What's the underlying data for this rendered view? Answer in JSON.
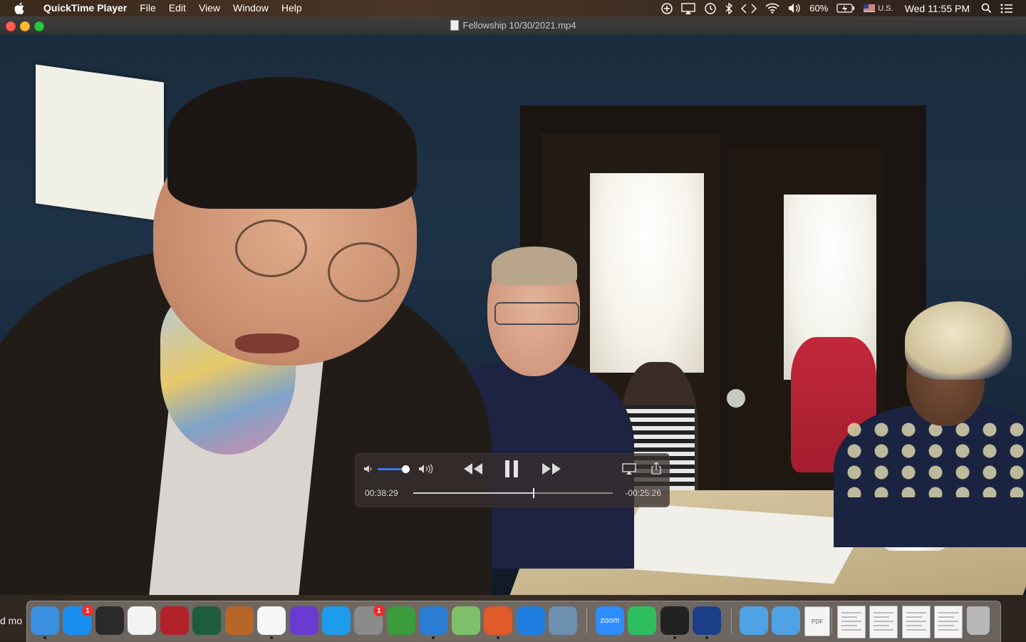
{
  "menubar": {
    "app_name": "QuickTime Player",
    "menus": [
      "File",
      "Edit",
      "View",
      "Window",
      "Help"
    ],
    "battery": "60%",
    "input_source": "U.S.",
    "clock": "Wed 11:55 PM"
  },
  "window": {
    "title": "Fellowship 10/30/2021.mp4"
  },
  "player": {
    "elapsed": "00:38:29",
    "remaining": "-00:25:26",
    "progress": 0.602,
    "volume": 0.87
  },
  "dock": {
    "left_edge_text": "d mo",
    "items": [
      {
        "name": "finder-icon",
        "color": "#3b8fe0",
        "running": true
      },
      {
        "name": "app-store-icon",
        "color": "#1a8ef0",
        "badge": "1",
        "running": false
      },
      {
        "name": "launchpad-icon",
        "color": "#2a2a2a",
        "running": false
      },
      {
        "name": "music-icon",
        "color": "#f3f3f3",
        "running": false
      },
      {
        "name": "photo-booth-icon",
        "color": "#b2222a",
        "running": false
      },
      {
        "name": "time-machine-icon",
        "color": "#1d5d3c",
        "running": false
      },
      {
        "name": "garageband-icon",
        "color": "#b7662a",
        "running": false
      },
      {
        "name": "photos-icon",
        "color": "#f6f6f6",
        "running": true
      },
      {
        "name": "imovie-icon",
        "color": "#6a3bd0",
        "running": false
      },
      {
        "name": "skype-icon",
        "color": "#1c9cea",
        "running": false
      },
      {
        "name": "system-preferences-icon",
        "color": "#8a8a8a",
        "badge": "1",
        "running": false
      },
      {
        "name": "sketchup-icon",
        "color": "#3a9c3a",
        "running": false
      },
      {
        "name": "word-icon",
        "color": "#2b7cd3",
        "running": true
      },
      {
        "name": "maps-icon",
        "color": "#7ec06a",
        "running": false
      },
      {
        "name": "firefox-icon",
        "color": "#e05a2a",
        "running": true
      },
      {
        "name": "safari-icon",
        "color": "#1f7fe0",
        "running": false
      },
      {
        "name": "preview-icon",
        "color": "#6d8fb0",
        "running": false
      },
      {
        "name": "zoom-icon",
        "color": "#2d8cff",
        "label": "zoom",
        "running": false
      },
      {
        "name": "evernote-icon",
        "color": "#2dbe60",
        "running": false
      },
      {
        "name": "spinning-icon",
        "color": "#222222",
        "running": true
      },
      {
        "name": "quicktime-icon",
        "color": "#1d3f8a",
        "running": true
      },
      {
        "name": "folder-icon",
        "color": "#4fa3e4",
        "running": false
      },
      {
        "name": "applications-folder-icon",
        "color": "#4fa3e4",
        "running": false
      },
      {
        "name": "pdf-document-icon",
        "color": "#f4f4f4",
        "label": "PDF",
        "running": false
      },
      {
        "name": "document-thumbnail-1",
        "color": "#f4f4f4",
        "running": false
      },
      {
        "name": "document-thumbnail-2",
        "color": "#f4f4f4",
        "running": false
      },
      {
        "name": "document-thumbnail-3",
        "color": "#f4f4f4",
        "running": false
      },
      {
        "name": "document-thumbnail-4",
        "color": "#f4f4f4",
        "running": false
      },
      {
        "name": "trash-icon",
        "color": "#b8b8b8",
        "running": false
      }
    ]
  }
}
